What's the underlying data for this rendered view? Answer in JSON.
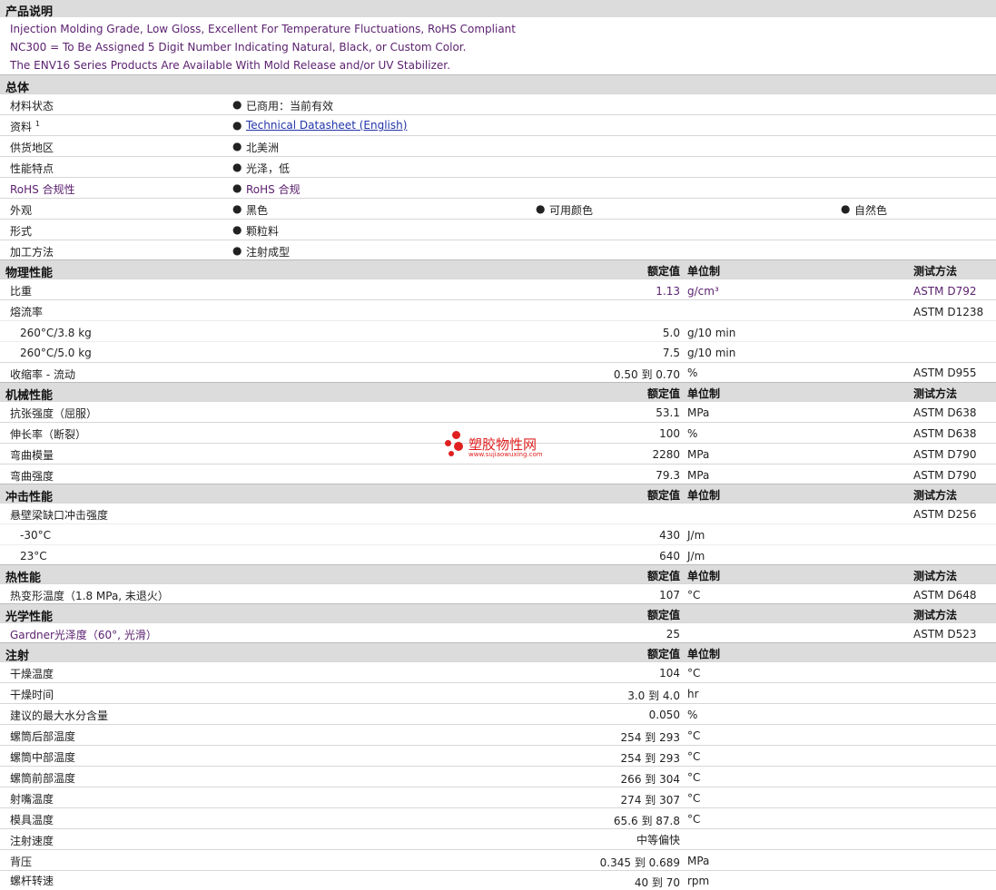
{
  "product_desc": {
    "title": "产品说明",
    "lines": [
      "Injection Molding Grade, Low Gloss, Excellent For Temperature Fluctuations, RoHS Compliant",
      "NC300 = To Be Assigned 5 Digit Number Indicating Natural, Black, or Custom Color.",
      "The ENV16 Series Products Are Available With Mold Release and/or UV Stabilizer."
    ]
  },
  "general": {
    "title": "总体",
    "rows": [
      {
        "label": "材料状态",
        "values": [
          "已商用：当前有效"
        ]
      },
      {
        "label": "资料",
        "sup": "1",
        "values": [
          "Technical Datasheet (English)"
        ]
      },
      {
        "label": "供货地区",
        "values": [
          "北美洲"
        ]
      },
      {
        "label": "性能特点",
        "values": [
          "光泽，低"
        ]
      },
      {
        "label": "RoHS 合规性",
        "values": [
          "RoHS 合规"
        ]
      },
      {
        "label": "外观",
        "values": [
          "黑色",
          "可用颜色",
          "自然色"
        ]
      },
      {
        "label": "形式",
        "values": [
          "颗粒料"
        ]
      },
      {
        "label": "加工方法",
        "values": [
          "注射成型"
        ]
      }
    ]
  },
  "headers": {
    "value": "额定值",
    "unit": "单位制",
    "method": "测试方法"
  },
  "physical": {
    "title": "物理性能",
    "rows": [
      {
        "label": "比重",
        "value": "1.13",
        "unit": "g/cm³",
        "method": "ASTM D792"
      },
      {
        "label": "熔流率",
        "value": "",
        "unit": "",
        "method": "ASTM D1238"
      },
      {
        "label": "260°C/3.8 kg",
        "value": "5.0",
        "unit": "g/10 min",
        "method": ""
      },
      {
        "label": "260°C/5.0 kg",
        "value": "7.5",
        "unit": "g/10 min",
        "method": ""
      },
      {
        "label": "收缩率 - 流动",
        "value": "0.50 到  0.70",
        "unit": "%",
        "method": "ASTM D955"
      }
    ]
  },
  "mechanical": {
    "title": "机械性能",
    "rows": [
      {
        "label": "抗张强度（屈服）",
        "value": "53.1",
        "unit": "MPa",
        "method": "ASTM D638"
      },
      {
        "label": "伸长率（断裂）",
        "value": "100",
        "unit": "%",
        "method": "ASTM D638"
      },
      {
        "label": "弯曲模量",
        "value": "2280",
        "unit": "MPa",
        "method": "ASTM D790"
      },
      {
        "label": "弯曲强度",
        "value": "79.3",
        "unit": "MPa",
        "method": "ASTM D790"
      }
    ]
  },
  "impact": {
    "title": "冲击性能",
    "rows": [
      {
        "label": "悬壁梁缺口冲击强度",
        "value": "",
        "unit": "",
        "method": "ASTM D256"
      },
      {
        "label": "-30°C",
        "value": "430",
        "unit": "J/m",
        "method": ""
      },
      {
        "label": "23°C",
        "value": "640",
        "unit": "J/m",
        "method": ""
      }
    ]
  },
  "thermal": {
    "title": "热性能",
    "rows": [
      {
        "label": "热变形温度（1.8 MPa, 未退火）",
        "value": "107",
        "unit": "°C",
        "method": "ASTM D648"
      }
    ]
  },
  "optical": {
    "title": "光学性能",
    "rows": [
      {
        "label": "Gardner光泽度（60°, 光滑）",
        "value": "25",
        "unit": "",
        "method": "ASTM D523"
      }
    ]
  },
  "injection": {
    "title": "注射",
    "rows": [
      {
        "label": "干燥温度",
        "value": "104",
        "unit": "°C"
      },
      {
        "label": "干燥时间",
        "value": "3.0 到  4.0",
        "unit": "hr"
      },
      {
        "label": "建议的最大水分含量",
        "value": "0.050",
        "unit": "%"
      },
      {
        "label": "螺筒后部温度",
        "value": "254 到  293",
        "unit": "°C"
      },
      {
        "label": "螺筒中部温度",
        "value": "254 到  293",
        "unit": "°C"
      },
      {
        "label": "螺筒前部温度",
        "value": "266 到  304",
        "unit": "°C"
      },
      {
        "label": "射嘴温度",
        "value": "274 到  307",
        "unit": "°C"
      },
      {
        "label": "模具温度",
        "value": "65.6 到  87.8",
        "unit": "°C"
      },
      {
        "label": "注射速度",
        "value": "中等偏快",
        "unit": ""
      },
      {
        "label": "背压",
        "value": "0.345 到  0.689",
        "unit": "MPa"
      },
      {
        "label": "螺杆转速",
        "value": "40 到  70",
        "unit": "rpm"
      }
    ]
  },
  "watermark": {
    "name": "塑胶物性网",
    "url": "www.sujiaowuxing.com",
    "color": "#e02020"
  }
}
